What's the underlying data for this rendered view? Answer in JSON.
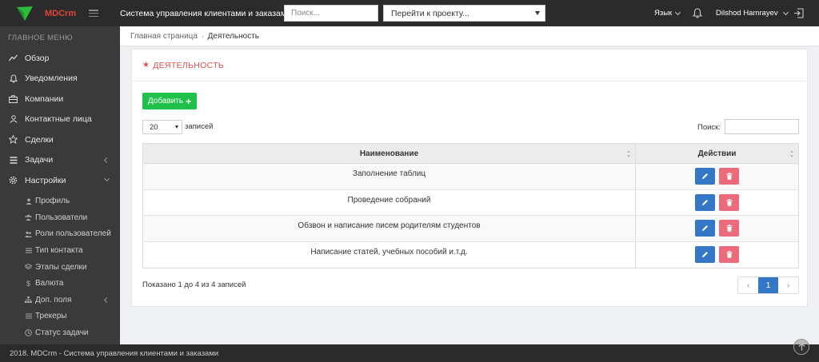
{
  "header": {
    "brand": "MDCrm",
    "app_title": "Система управления клиентами и заказами",
    "search_placeholder": "Поиск...",
    "project_select": "Перейти к проекту...",
    "language": "Язык",
    "user_name": "Dilshod Hamrayev"
  },
  "sidebar": {
    "heading": "ГЛАВНОЕ МЕНЮ",
    "items": [
      {
        "label": "Обзор",
        "icon": "chart-line-icon"
      },
      {
        "label": "Уведомления",
        "icon": "bell-icon"
      },
      {
        "label": "Компании",
        "icon": "briefcase-icon"
      },
      {
        "label": "Контактные лица",
        "icon": "user-icon"
      },
      {
        "label": "Сделки",
        "icon": "star-icon"
      },
      {
        "label": "Задачи",
        "icon": "list-icon"
      },
      {
        "label": "Настройки",
        "icon": "gear-icon"
      }
    ],
    "sub_items": [
      {
        "label": "Профиль",
        "icon": "user-icon"
      },
      {
        "label": "Пользователи",
        "icon": "users-icon"
      },
      {
        "label": "Роли пользователей",
        "icon": "users-icon"
      },
      {
        "label": "Тип контакта",
        "icon": "list-icon"
      },
      {
        "label": "Этапы сделки",
        "icon": "layers-icon"
      },
      {
        "label": "Валюта",
        "icon": "dollar-icon"
      },
      {
        "label": "Доп. поля",
        "icon": "sitemap-icon"
      },
      {
        "label": "Трекеры",
        "icon": "list-icon"
      },
      {
        "label": "Статус задачи",
        "icon": "clock-icon"
      }
    ]
  },
  "breadcrumb": {
    "home": "Главная страница",
    "current": "Деятельность"
  },
  "panel": {
    "title": "ДЕЯТЕЛЬНОСТЬ",
    "add_label": "Добавить",
    "page_length": "20",
    "page_length_label": "записей",
    "filter_label": "Поиск:",
    "columns": [
      "Наименование",
      "Действии"
    ],
    "rows": [
      {
        "name": "Заполнение таблиц"
      },
      {
        "name": "Проведение собраний"
      },
      {
        "name": "Обзвон и написание писем родителям студентов"
      },
      {
        "name": "Написание статей, учебных пособий и.т.д."
      }
    ],
    "info": "Показано 1 до 4 из 4 записей",
    "pager": {
      "prev": "‹",
      "current": "1",
      "next": "›"
    }
  },
  "footer": {
    "text": "2018. MDCrm - Система управления клиентами и заказами"
  },
  "colors": {
    "accent_red": "#d9534f",
    "add_green": "#20c14a",
    "edit_blue": "#3477c7",
    "delete_pink": "#ec6b7a",
    "topbar": "#2b2b2b",
    "sidebar": "#3a3a3a"
  }
}
